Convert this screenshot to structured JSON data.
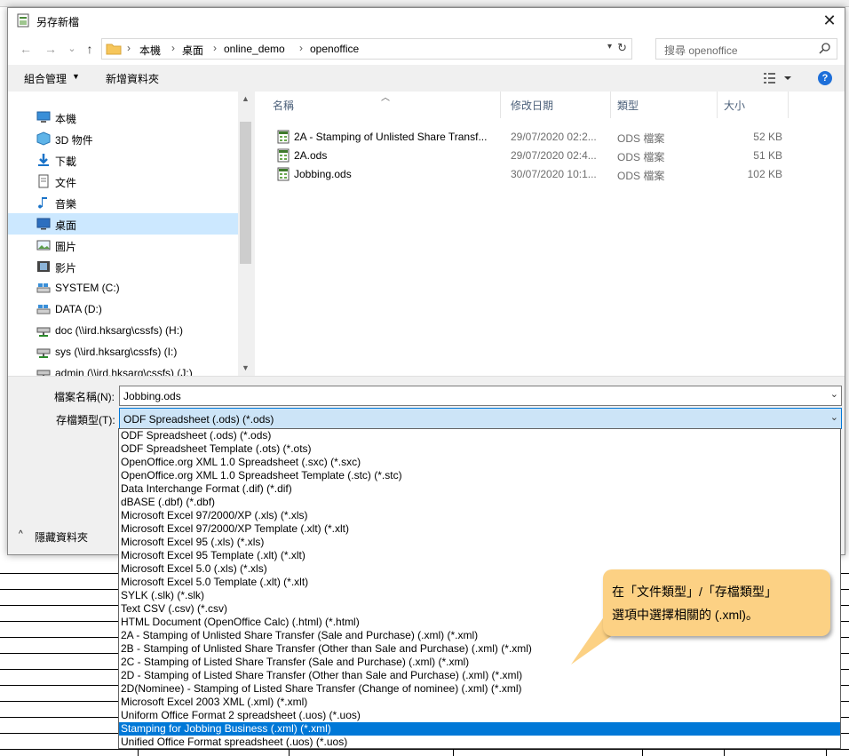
{
  "dialog": {
    "title": "另存新檔",
    "close_glyph": "✕"
  },
  "nav": {
    "back_glyph": "←",
    "forward_glyph": "→",
    "recent_glyph": "⌄",
    "up_glyph": "↑",
    "breadcrumbs": [
      "本機",
      "桌面",
      "online_demo",
      "openoffice"
    ],
    "crumb_sep": "›",
    "search_placeholder": "搜尋 openoffice"
  },
  "toolbar": {
    "organize_label": "組合管理",
    "new_folder_label": "新增資料夾",
    "help_glyph": "?"
  },
  "sidebar": {
    "items": [
      {
        "label": "本機",
        "icon": "pc-icon"
      },
      {
        "label": "3D 物件",
        "icon": "cube-icon"
      },
      {
        "label": "下載",
        "icon": "download-icon"
      },
      {
        "label": "文件",
        "icon": "document-icon"
      },
      {
        "label": "音樂",
        "icon": "music-icon"
      },
      {
        "label": "桌面",
        "icon": "desktop-icon",
        "selected": true
      },
      {
        "label": "圖片",
        "icon": "picture-icon"
      },
      {
        "label": "影片",
        "icon": "video-icon"
      },
      {
        "label": "SYSTEM (C:)",
        "icon": "drive-icon"
      },
      {
        "label": "DATA (D:)",
        "icon": "drive-icon"
      },
      {
        "label": "doc (\\\\ird.hksarg\\cssfs) (H:)",
        "icon": "network-drive-icon"
      },
      {
        "label": "sys (\\\\ird.hksarg\\cssfs) (I:)",
        "icon": "network-drive-icon"
      },
      {
        "label": "admin (\\\\ird.hksarg\\cssfs) (J:)",
        "icon": "network-drive-icon"
      }
    ]
  },
  "filelist": {
    "columns": {
      "name": "名稱",
      "date": "修改日期",
      "type": "類型",
      "size": "大小"
    },
    "rows": [
      {
        "name": "2A - Stamping of Unlisted Share Transf...",
        "date": "29/07/2020 02:2...",
        "type": "ODS 檔案",
        "size": "52 KB"
      },
      {
        "name": "2A.ods",
        "date": "29/07/2020 02:4...",
        "type": "ODS 檔案",
        "size": "51 KB"
      },
      {
        "name": "Jobbing.ods",
        "date": "30/07/2020 10:1...",
        "type": "ODS 檔案",
        "size": "102 KB"
      }
    ]
  },
  "form": {
    "filename_label": "檔案名稱(N):",
    "filename_value": "Jobbing.ods",
    "filetype_label": "存檔類型(T):",
    "filetype_value": "ODF Spreadsheet (.ods) (*.ods)",
    "hide_folders_label": "隱藏資料夾"
  },
  "filetype_options": [
    "ODF Spreadsheet (.ods) (*.ods)",
    "ODF Spreadsheet Template (.ots) (*.ots)",
    "OpenOffice.org XML 1.0 Spreadsheet (.sxc) (*.sxc)",
    "OpenOffice.org XML 1.0 Spreadsheet Template (.stc) (*.stc)",
    "Data Interchange Format (.dif) (*.dif)",
    "dBASE (.dbf) (*.dbf)",
    "Microsoft Excel 97/2000/XP (.xls) (*.xls)",
    "Microsoft Excel 97/2000/XP Template (.xlt) (*.xlt)",
    "Microsoft Excel 95 (.xls) (*.xls)",
    "Microsoft Excel 95 Template (.xlt) (*.xlt)",
    "Microsoft Excel 5.0 (.xls) (*.xls)",
    "Microsoft Excel 5.0 Template (.xlt) (*.xlt)",
    "SYLK (.slk) (*.slk)",
    "Text CSV (.csv) (*.csv)",
    "HTML Document (OpenOffice Calc) (.html) (*.html)",
    "2A - Stamping of Unlisted Share Transfer (Sale and Purchase) (.xml) (*.xml)",
    "2B - Stamping of Unlisted Share Transfer (Other than Sale and Purchase) (.xml) (*.xml)",
    "2C - Stamping of Listed Share Transfer (Sale and Purchase) (.xml) (*.xml)",
    "2D - Stamping of Listed Share Transfer (Other than Sale and Purchase) (.xml) (*.xml)",
    "2D(Nominee) - Stamping of Listed Share Transfer (Change of nominee) (.xml) (*.xml)",
    "Microsoft Excel 2003 XML (.xml) (*.xml)",
    "Uniform Office Format 2 spreadsheet (.uos) (*.uos)",
    "Stamping for Jobbing Business (.xml) (*.xml)",
    "Unified Office Format spreadsheet (.uos) (*.uos)"
  ],
  "selected_option_index": 22,
  "callout": {
    "line1": "在「文件類型」/「存檔類型」",
    "line2": "選項中選擇相關的 (.xml)。"
  },
  "colors": {
    "accent": "#0078d7",
    "selection": "#cce8ff",
    "callout": "#fcd184"
  }
}
